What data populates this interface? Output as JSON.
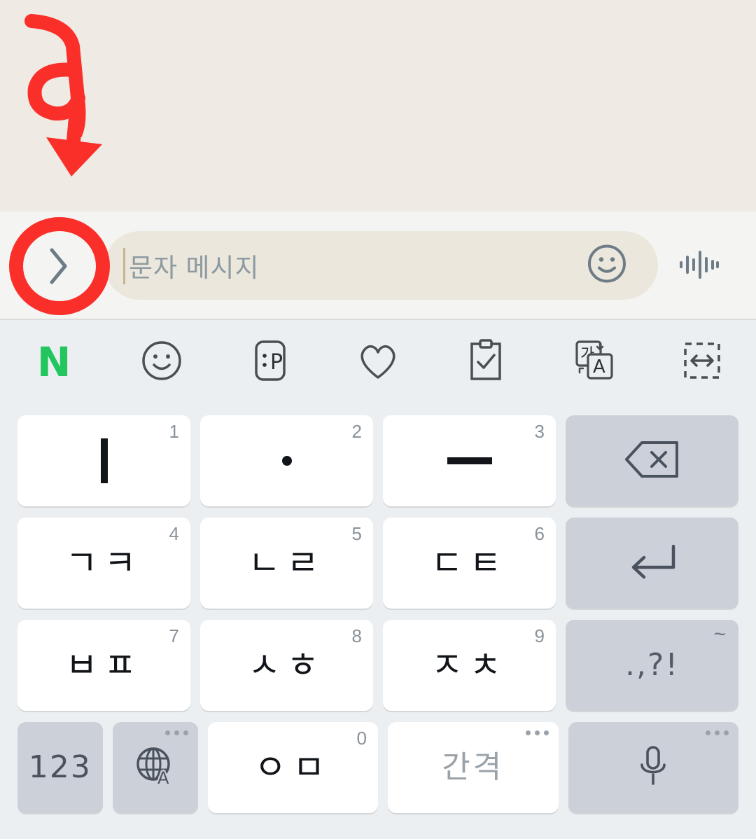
{
  "app": {
    "chat_background_color": "#efeae3",
    "keyboard_background_color": "#eceff1"
  },
  "input_bar": {
    "expand_button_icon": "chevron-right-icon",
    "placeholder": "문자 메시지",
    "value": "",
    "emoji_button_icon": "smiley-face-icon",
    "voice_button_icon": "audio-waveform-icon",
    "field_background_color": "#ece7dc"
  },
  "keyboard_toolbar": {
    "items": [
      {
        "name": "naver-logo",
        "label": "N",
        "color": "#22c55e"
      },
      {
        "name": "emoji-icon",
        "label": ""
      },
      {
        "name": "emoticon-icon",
        "label": ":P"
      },
      {
        "name": "heart-icon",
        "label": ""
      },
      {
        "name": "clipboard-check-icon",
        "label": ""
      },
      {
        "name": "translate-icon",
        "label": "가 A"
      },
      {
        "name": "resize-keyboard-icon",
        "label": ""
      }
    ]
  },
  "keyboard": {
    "layout_name": "chunjiin",
    "rows": [
      {
        "keys": [
          {
            "name": "key-i",
            "label": "",
            "glyph": "vertical-stroke",
            "corner": "1",
            "style": "white"
          },
          {
            "name": "key-dot",
            "label": "",
            "glyph": "dot",
            "corner": "2",
            "style": "white"
          },
          {
            "name": "key-eu",
            "label": "",
            "glyph": "horizontal-stroke",
            "corner": "3",
            "style": "white"
          },
          {
            "name": "key-backspace",
            "label": "",
            "glyph": "backspace-icon",
            "corner": "",
            "style": "gray"
          }
        ]
      },
      {
        "keys": [
          {
            "name": "key-giyeok-kieuk",
            "label": "ㄱㅋ",
            "glyph": "",
            "corner": "4",
            "style": "white"
          },
          {
            "name": "key-nieun-rieul",
            "label": "ㄴㄹ",
            "glyph": "",
            "corner": "5",
            "style": "white"
          },
          {
            "name": "key-digeut-tieut",
            "label": "ㄷㅌ",
            "glyph": "",
            "corner": "6",
            "style": "white"
          },
          {
            "name": "key-enter",
            "label": "",
            "glyph": "return-icon",
            "corner": "",
            "style": "gray"
          }
        ]
      },
      {
        "keys": [
          {
            "name": "key-bieup-pieup",
            "label": "ㅂㅍ",
            "glyph": "",
            "corner": "7",
            "style": "white"
          },
          {
            "name": "key-siot-hieut",
            "label": "ㅅㅎ",
            "glyph": "",
            "corner": "8",
            "style": "white"
          },
          {
            "name": "key-jieut-chieut",
            "label": "ㅈㅊ",
            "glyph": "",
            "corner": "9",
            "style": "white"
          },
          {
            "name": "key-punctuation",
            "label": ".,?!",
            "glyph": "",
            "corner": "~",
            "style": "gray"
          }
        ]
      },
      {
        "keys": [
          {
            "name": "key-numeric",
            "label": "123",
            "glyph": "",
            "corner": "",
            "style": "gray"
          },
          {
            "name": "key-language",
            "label": "",
            "glyph": "globe-language-icon",
            "corner": "dots",
            "style": "gray"
          },
          {
            "name": "key-ieung-mieum",
            "label": "ㅇㅁ",
            "glyph": "",
            "corner": "0",
            "style": "white"
          },
          {
            "name": "key-space",
            "label": "간격",
            "glyph": "",
            "corner": "dots",
            "style": "white"
          },
          {
            "name": "key-microphone",
            "label": "",
            "glyph": "microphone-icon",
            "corner": "dots",
            "style": "gray"
          }
        ]
      }
    ]
  },
  "annotation": {
    "color": "#fa2f2a",
    "shapes": [
      {
        "name": "curved-down-arrow",
        "description": "hand drawn red arrow with loop pointing down"
      },
      {
        "name": "circle-highlight",
        "description": "red circle around expand chevron button"
      }
    ]
  }
}
